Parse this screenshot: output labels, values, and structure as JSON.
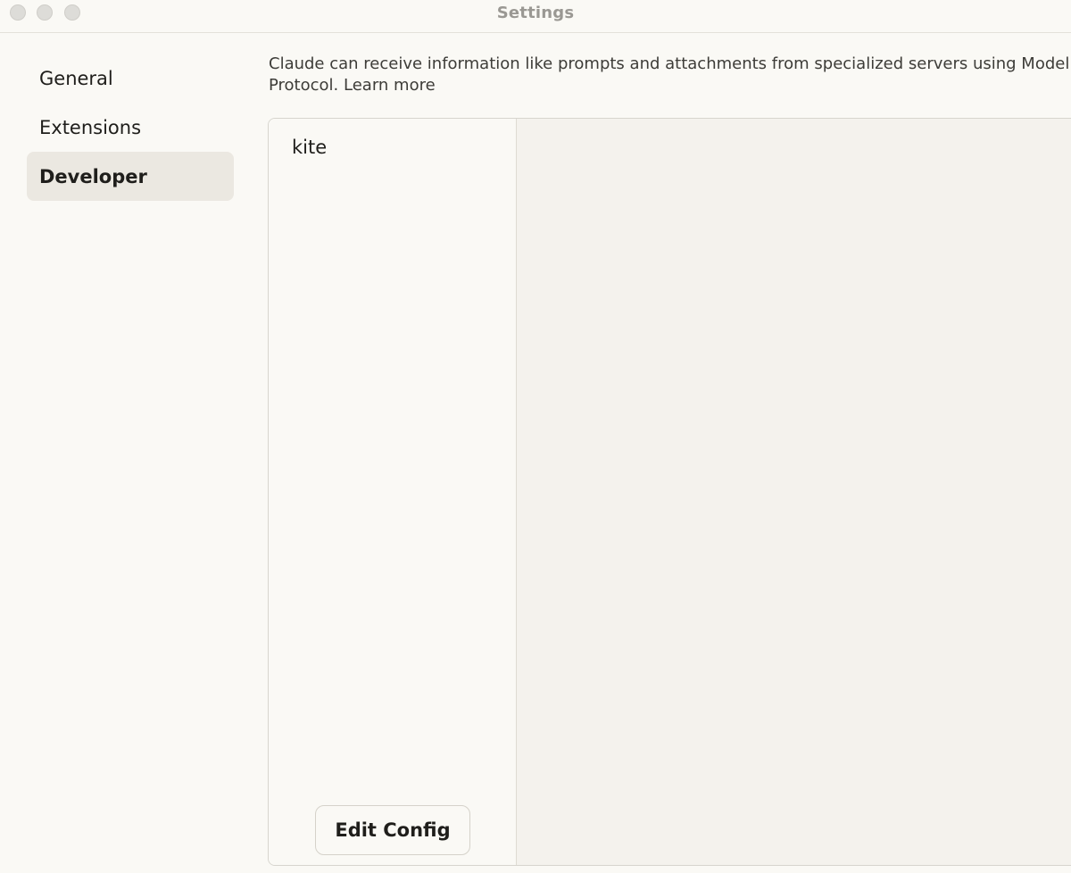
{
  "window": {
    "title": "Settings"
  },
  "sidebar": {
    "items": [
      {
        "label": "General",
        "active": false
      },
      {
        "label": "Extensions",
        "active": false
      },
      {
        "label": "Developer",
        "active": true
      }
    ]
  },
  "main": {
    "description": "Claude can receive information like prompts and attachments from specialized servers using Model Context Protocol.",
    "learn_more": "Learn more",
    "servers": [
      {
        "name": "kite"
      }
    ],
    "edit_config_label": "Edit Config"
  },
  "colors": {
    "background": "#faf9f5",
    "active_nav": "#ebe8e1",
    "detail_pane": "#f4f2ed"
  }
}
